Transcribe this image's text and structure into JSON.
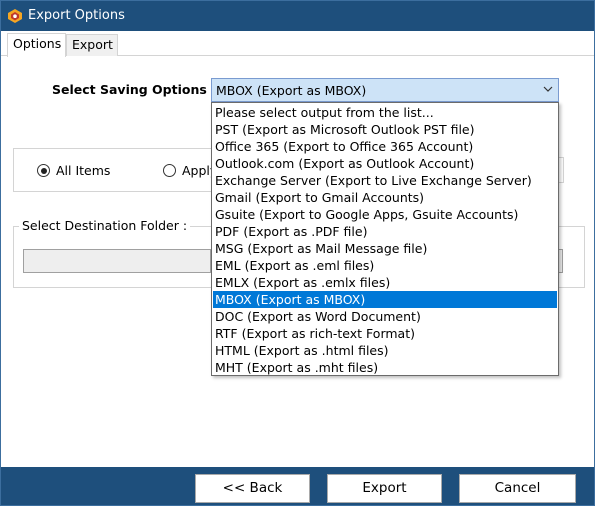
{
  "window": {
    "title": "Export Options"
  },
  "tabs": [
    {
      "label": "Options",
      "active": true
    },
    {
      "label": "Export",
      "active": false
    }
  ],
  "saving": {
    "label": "Select Saving Options :",
    "selected": "MBOX (Export as MBOX)",
    "options": [
      "Please select output from the list...",
      "PST (Export as Microsoft Outlook PST file)",
      "Office 365 (Export to Office 365 Account)",
      "Outlook.com (Export as Outlook Account)",
      "Exchange Server (Export to Live Exchange Server)",
      "Gmail (Export to Gmail Accounts)",
      "Gsuite (Export to Google Apps, Gsuite Accounts)",
      "PDF (Export as .PDF file)",
      "MSG (Export as Mail Message file)",
      "EML (Export as .eml files)",
      "EMLX (Export as .emlx files)",
      "MBOX (Export as MBOX)",
      "DOC (Export as Word Document)",
      "RTF (Export as rich-text Format)",
      "HTML (Export as .html files)",
      "MHT (Export as .mht files)"
    ],
    "selected_index": 11
  },
  "items": {
    "all_label": "All Items",
    "all_checked": true,
    "apply_label": "Apply",
    "apply_checked": false
  },
  "destination": {
    "label": "Select Destination Folder :",
    "path": ""
  },
  "buttons": {
    "back": "<< Back",
    "export": "Export",
    "cancel": "Cancel"
  },
  "colors": {
    "titlebar": "#1e4f7c",
    "selection": "#0078d7",
    "select_box": "#cde3f7"
  }
}
